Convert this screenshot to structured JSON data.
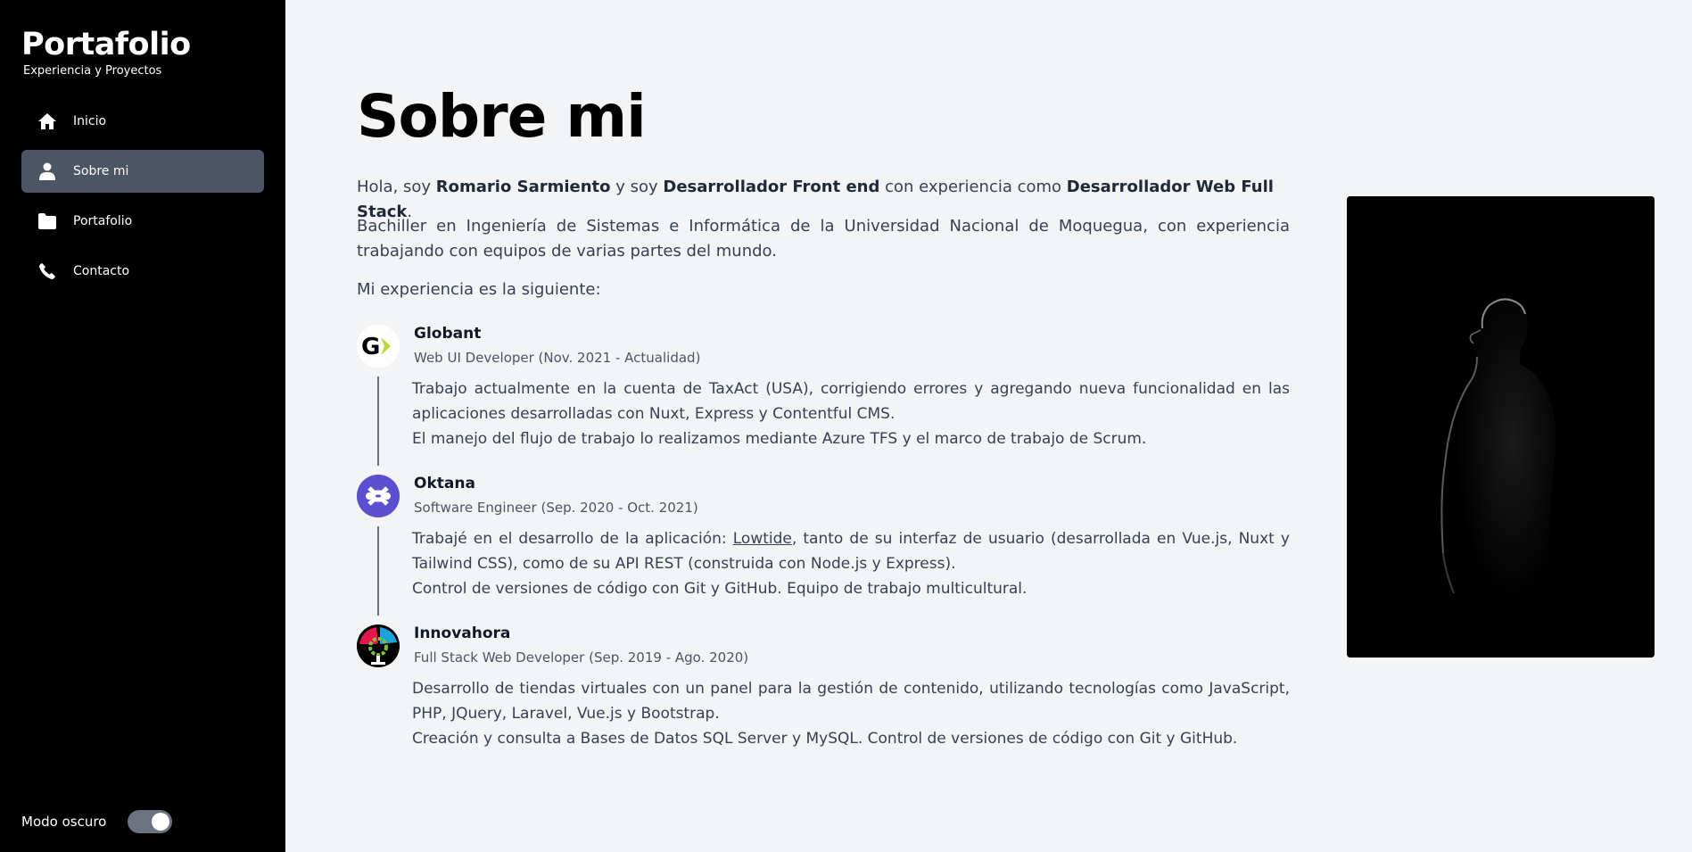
{
  "sidebar": {
    "brand_title": "Portafolio",
    "brand_subtitle": "Experiencia y Proyectos",
    "items": [
      {
        "label": "Inicio",
        "icon": "home-icon",
        "active": false
      },
      {
        "label": "Sobre mi",
        "icon": "user-icon",
        "active": true
      },
      {
        "label": "Portafolio",
        "icon": "folder-icon",
        "active": false
      },
      {
        "label": "Contacto",
        "icon": "phone-icon",
        "active": false
      }
    ],
    "dark_mode_label": "Modo oscuro",
    "dark_mode_on": true
  },
  "main": {
    "title": "Sobre mi",
    "intro": {
      "p1": "Hola, soy ",
      "name": "Romario Sarmiento",
      "p2": " y soy ",
      "role": "Desarrollador Front end",
      "p3": " con experiencia como ",
      "role2": "Desarrollador Web Full Stack",
      "p4": "."
    },
    "bachelor": "Bachiller en Ingeniería de Sistemas e Informática de la Universidad Nacional de Moquegua, con experiencia trabajando con equipos de varias partes del mundo.",
    "experience_intro": "Mi experiencia es la siguiente:",
    "jobs": [
      {
        "company": "Globant",
        "role": "Web UI Developer (Nov. 2021 - Actualidad)",
        "desc1": "Trabajo actualmente en la cuenta de TaxAct (USA), corrigiendo errores y agregando nueva funcionalidad en las aplicaciones desarrolladas con Nuxt, Express y Contentful CMS.",
        "desc2": "El manejo del flujo de trabajo lo realizamos mediante Azure TFS y el marco de trabajo de Scrum."
      },
      {
        "company": "Oktana",
        "role": "Software Engineer (Sep. 2020 - Oct. 2021)",
        "desc1_pre": "Trabajé en el desarrollo de la aplicación: ",
        "desc1_link": "Lowtide",
        "desc1_post": ", tanto de su interfaz de usuario (desarrollada en Vue.js, Nuxt y Tailwind CSS), como de su API REST (construida con Node.js y Express).",
        "desc2": "Control de versiones de código con Git y GitHub. Equipo de trabajo multicultural."
      },
      {
        "company": "Innovahora",
        "role": "Full Stack Web Developer (Sep. 2019 - Ago. 2020)",
        "desc1": "Desarrollo de tiendas virtuales con un panel para la gestión de contenido, utilizando tecnologías como JavaScript, PHP, JQuery, Laravel, Vue.js y Bootstrap.",
        "desc2": "Creación y consulta a Bases de Datos SQL Server y MySQL. Control de versiones de código con Git y GitHub."
      }
    ]
  },
  "colors": {
    "sidebar_bg": "#000000",
    "active_item_bg": "#4b5563",
    "main_bg": "#f3f4f6",
    "oktana_logo": "#5b4fcf",
    "globant_green": "#bfd730"
  }
}
